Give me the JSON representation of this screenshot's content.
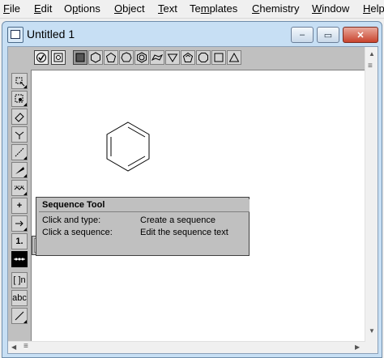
{
  "menu": {
    "items": [
      {
        "label": "File",
        "u": "F",
        "rest": "ile"
      },
      {
        "label": "Edit",
        "u": "E",
        "rest": "dit"
      },
      {
        "label": "Options",
        "pre": "O",
        "u": "p",
        "rest": "tions"
      },
      {
        "label": "Object",
        "u": "O",
        "rest": "bject"
      },
      {
        "label": "Text",
        "u": "T",
        "rest": "ext"
      },
      {
        "label": "Templates",
        "pre": "Te",
        "u": "m",
        "rest": "plates"
      },
      {
        "label": "Chemistry",
        "u": "C",
        "rest": "hemistry"
      },
      {
        "label": "Window",
        "u": "W",
        "rest": "indow"
      },
      {
        "label": "Help",
        "u": "H",
        "rest": "elp"
      }
    ]
  },
  "window": {
    "title": "Untitled 1",
    "buttons": {
      "minimize": "–",
      "maximize": "▭",
      "close": "✕"
    }
  },
  "left_tools": {
    "labels": {
      "chain": "1.",
      "bracket": "[ ]n",
      "text": "abc",
      "plus": "+"
    }
  },
  "tooltip": {
    "title": "Sequence Tool",
    "rows": [
      {
        "action": "Click and type:",
        "result": "Create a sequence"
      },
      {
        "action": "Click a sequence:",
        "result": "Edit the sequence text"
      }
    ]
  },
  "scroll": {
    "up": "▲",
    "down": "▼",
    "left": "◀",
    "right": "▶",
    "thumb": "≡"
  },
  "colors": {
    "window_frame": "#c7dff4",
    "close_button": "#c9442e",
    "toolbar": "#c0c0c0"
  }
}
